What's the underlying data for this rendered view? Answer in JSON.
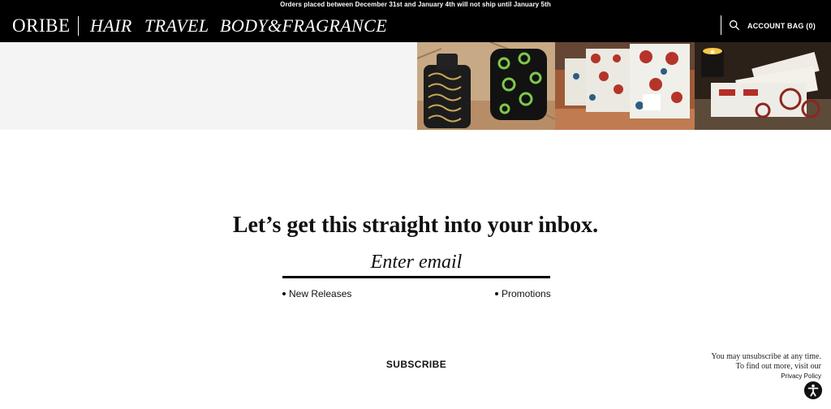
{
  "announcement": "Orders placed between December 31st and January 4th will not ship until January 5th",
  "header": {
    "logo": "ORIBE",
    "categories": [
      "HAIR",
      "TRAVEL",
      "BODY&FRAGRANCE"
    ],
    "search_icon": "search-icon",
    "account_label": "ACCOUNT",
    "bag_label": "BAG (0)"
  },
  "hero": {
    "photos": [
      "product-bottles-photo",
      "gift-boxes-photo",
      "candle-gift-photo"
    ]
  },
  "newsletter": {
    "headline": "Let’s get this straight into your inbox.",
    "email_placeholder": "Enter email",
    "options": [
      "New Releases",
      "Promotions"
    ],
    "subscribe_label": "SUBSCRIBE",
    "legal_line1": "You may unsubscribe at any time.",
    "legal_line2": "To find out more, visit our",
    "policy_label": "Privacy Policy"
  },
  "colors": {
    "header_bg": "#000000",
    "header_text": "#ffffff",
    "panel_bg": "#f4f4f4",
    "text": "#111111"
  }
}
